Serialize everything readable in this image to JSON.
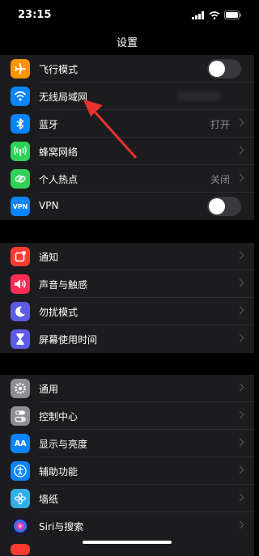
{
  "status": {
    "time": "23:15"
  },
  "nav": {
    "title": "设置"
  },
  "group1": [
    {
      "label": "飞行模式",
      "value": "",
      "color": "#ff9500",
      "icon": "airplane-icon"
    },
    {
      "label": "无线局域网",
      "value": "",
      "color": "#0a84ff",
      "icon": "wifi-icon"
    },
    {
      "label": "蓝牙",
      "value": "打开",
      "color": "#0a84ff",
      "icon": "bluetooth-icon"
    },
    {
      "label": "蜂窝网络",
      "value": "",
      "color": "#30d158",
      "icon": "antenna-icon"
    },
    {
      "label": "个人热点",
      "value": "关闭",
      "color": "#30d158",
      "icon": "hotspot-icon"
    },
    {
      "label": "VPN",
      "value": "",
      "color": "#0a84ff",
      "icon_text": "VPN",
      "icon": "vpn-icon"
    }
  ],
  "group2": [
    {
      "label": "通知",
      "color": "#ff3b30",
      "icon": "notification-icon"
    },
    {
      "label": "声音与触感",
      "color": "#ff2d55",
      "icon": "speaker-icon"
    },
    {
      "label": "勿扰模式",
      "color": "#5e5ce6",
      "icon": "moon-icon"
    },
    {
      "label": "屏幕使用时间",
      "color": "#5e5ce6",
      "icon": "hourglass-icon"
    }
  ],
  "group3": [
    {
      "label": "通用",
      "color": "#8e8e93",
      "icon": "gear-icon"
    },
    {
      "label": "控制中心",
      "color": "#8e8e93",
      "icon": "switches-icon"
    },
    {
      "label": "显示与亮度",
      "color": "#0a84ff",
      "icon_text": "AA",
      "icon": "display-icon"
    },
    {
      "label": "辅助功能",
      "color": "#0a84ff",
      "icon": "accessibility-icon"
    },
    {
      "label": "墙纸",
      "color": "#32ade6",
      "icon": "flower-icon"
    },
    {
      "label": "Siri与搜索",
      "color": "#3a3a6a",
      "icon": "siri-icon"
    }
  ],
  "annotation": {
    "color": "#e8332e"
  }
}
